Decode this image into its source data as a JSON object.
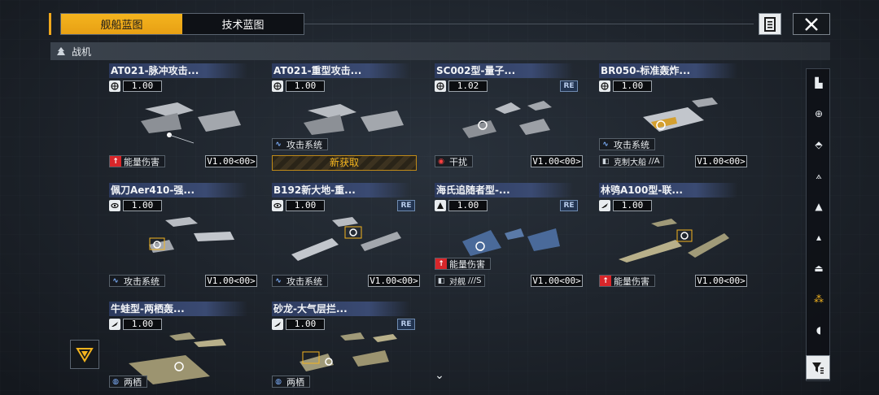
{
  "tabs": [
    {
      "label": "舰船蓝图",
      "active": true
    },
    {
      "label": "技术蓝图",
      "active": false
    }
  ],
  "section": {
    "title": "战机"
  },
  "cards": [
    {
      "title": "AT021-脉冲攻击...",
      "version": "1.00",
      "version_icon": "globe-icon",
      "re": false,
      "tags": [
        {
          "label": "能量伤害",
          "icon": "energy-damage-icon"
        }
      ],
      "build": "V1.00<00>",
      "new_banner": ""
    },
    {
      "title": "AT021-重型攻击...",
      "version": "1.00",
      "version_icon": "globe-icon",
      "re": false,
      "tags": [
        {
          "label": "攻击系统",
          "icon": "wave-icon"
        }
      ],
      "build": "",
      "new_banner": "新获取"
    },
    {
      "title": "SC002型-量子...",
      "version": "1.02",
      "version_icon": "globe-icon",
      "re": true,
      "tags": [
        {
          "label": "干扰",
          "icon": "jam-icon"
        }
      ],
      "build": "V1.00<00>",
      "new_banner": ""
    },
    {
      "title": "BR050-标准轰炸...",
      "version": "1.00",
      "version_icon": "globe-icon",
      "re": false,
      "tags": [
        {
          "label": "攻击系统",
          "icon": "wave-icon"
        },
        {
          "label": "克制大船",
          "icon": "counter-icon",
          "rank": "//A"
        }
      ],
      "build": "V1.00<00>",
      "new_banner": ""
    },
    {
      "title": "佩刀Aer410-强...",
      "version": "1.00",
      "version_icon": "eye-icon",
      "re": false,
      "tags": [
        {
          "label": "攻击系统",
          "icon": "wave-icon"
        }
      ],
      "build": "V1.00<00>",
      "new_banner": ""
    },
    {
      "title": "B192新大地-重...",
      "version": "1.00",
      "version_icon": "eye-icon",
      "re": true,
      "tags": [
        {
          "label": "攻击系统",
          "icon": "wave-icon"
        }
      ],
      "build": "V1.00<00>",
      "new_banner": ""
    },
    {
      "title": "海氏追随者型-...",
      "version": "1.00",
      "version_icon": "tri-icon",
      "re": true,
      "tags": [
        {
          "label": "能量伤害",
          "icon": "energy-damage-icon"
        },
        {
          "label": "对舰",
          "icon": "counter-icon",
          "rank": "///S"
        }
      ],
      "build": "V1.00<00>",
      "new_banner": ""
    },
    {
      "title": "林鸮A100型-联...",
      "version": "1.00",
      "version_icon": "wing-icon",
      "re": false,
      "tags": [
        {
          "label": "能量伤害",
          "icon": "energy-damage-icon"
        }
      ],
      "build": "V1.00<00>",
      "new_banner": ""
    },
    {
      "title": "牛蛙型-两栖轰...",
      "version": "1.00",
      "version_icon": "wing-icon",
      "re": false,
      "tags": [
        {
          "label": "两栖",
          "icon": "globe-icon"
        }
      ],
      "build": "",
      "new_banner": ""
    },
    {
      "title": "砂龙-大气层拦...",
      "version": "1.00",
      "version_icon": "wing-icon",
      "re": true,
      "tags": [
        {
          "label": "两栖",
          "icon": "globe-icon"
        }
      ],
      "build": "",
      "new_banner": ""
    }
  ],
  "re_label": "RE",
  "colors": {
    "accent": "#f4b41e",
    "title_bg": "#3a4a72",
    "energy": "#d8262a",
    "jam": "#d8262a"
  }
}
